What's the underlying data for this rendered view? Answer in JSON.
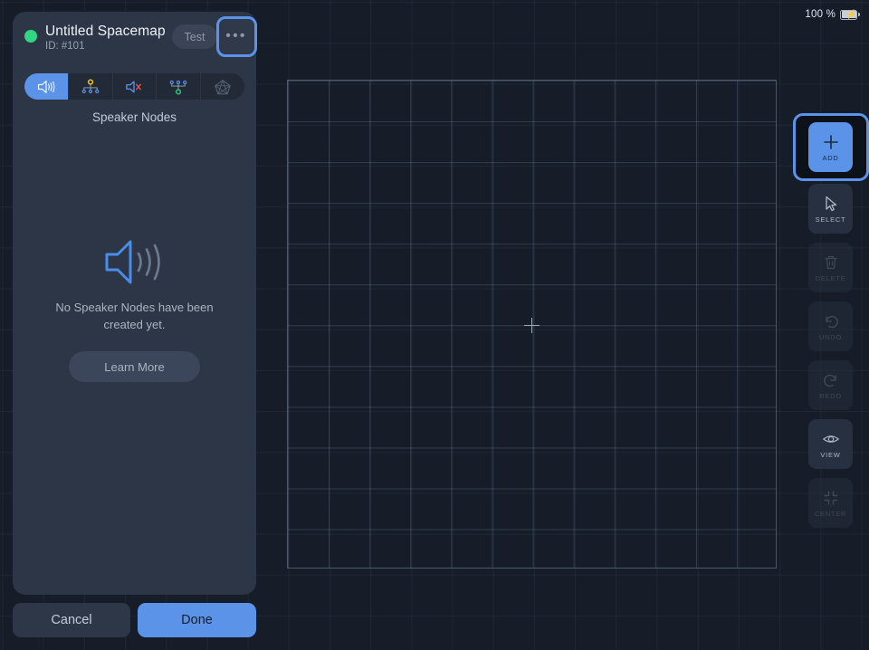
{
  "statusbar": {
    "battery_percent": "100 %",
    "battery_icon": "battery-charging-icon"
  },
  "panel": {
    "status_dot": "online-status-dot",
    "title": "Untitled Spacemap",
    "subtitle": "ID: #101",
    "test_label": "Test",
    "more_label": "•••",
    "segments": [
      {
        "id": "speaker-nodes",
        "icon": "speaker-wave-icon",
        "active": true
      },
      {
        "id": "source-nodes",
        "icon": "node-tree-up-icon",
        "active": false
      },
      {
        "id": "speaker-mute",
        "icon": "speaker-mute-icon",
        "active": false
      },
      {
        "id": "target-nodes",
        "icon": "node-tree-down-icon",
        "active": false
      },
      {
        "id": "polygon-nodes",
        "icon": "pentagon-mesh-icon",
        "active": false
      }
    ],
    "segment_label": "Speaker Nodes",
    "empty": {
      "icon": "speaker-wave-large-icon",
      "message": "No Speaker Nodes have been created yet.",
      "learn_more_label": "Learn More"
    },
    "footer": {
      "cancel_label": "Cancel",
      "done_label": "Done"
    }
  },
  "toolbar": {
    "items": [
      {
        "id": "add",
        "label": "ADD",
        "icon": "plus-icon",
        "state": "active"
      },
      {
        "id": "select",
        "label": "SELECT",
        "icon": "cursor-arrow-icon",
        "state": "enabled"
      },
      {
        "id": "delete",
        "label": "DELETE",
        "icon": "trash-icon",
        "state": "disabled"
      },
      {
        "id": "undo",
        "label": "UNDO",
        "icon": "undo-arrow-icon",
        "state": "disabled"
      },
      {
        "id": "redo",
        "label": "REDO",
        "icon": "redo-arrow-icon",
        "state": "disabled"
      },
      {
        "id": "view",
        "label": "VIEW",
        "icon": "eye-icon",
        "state": "enabled"
      },
      {
        "id": "center",
        "label": "CENTER",
        "icon": "center-crop-icon",
        "state": "disabled"
      }
    ]
  },
  "canvas": {
    "grid_label": "spacemap-grid",
    "crosshair_label": "origin-crosshair"
  },
  "colors": {
    "accent": "#5a93e8",
    "panel": "#2d3646",
    "canvas_bg": "#161d28",
    "page_bg": "#11161f",
    "status_green": "#31d583",
    "mute_red": "#e0534a",
    "node_yellow": "#f0c419",
    "node_green": "#2fbf6e"
  }
}
